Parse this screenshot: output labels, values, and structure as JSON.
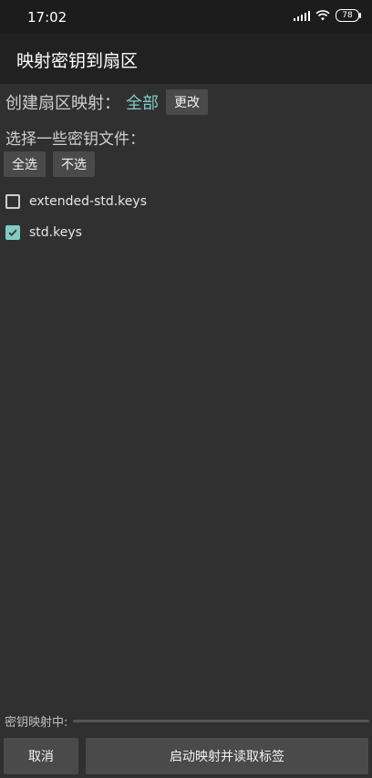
{
  "status": {
    "time": "17:02",
    "battery": "78"
  },
  "appbar": {
    "title": "映射密钥到扇区"
  },
  "sector_map": {
    "label": "创建扇区映射：",
    "value": "全部",
    "change_label": "更改"
  },
  "select_keys": {
    "label": "选择一些密钥文件："
  },
  "select_buttons": {
    "all": "全选",
    "none": "不选"
  },
  "key_files": [
    {
      "name": "extended-std.keys",
      "checked": false
    },
    {
      "name": "std.keys",
      "checked": true
    }
  ],
  "progress": {
    "label": "密钥映射中:",
    "value": 0
  },
  "bottom": {
    "cancel": "取消",
    "start": "启动映射并读取标签"
  },
  "colors": {
    "accent": "#80cbc4",
    "background": "#303030",
    "toolbar": "#212121",
    "statusbar": "#1c1c1c"
  }
}
